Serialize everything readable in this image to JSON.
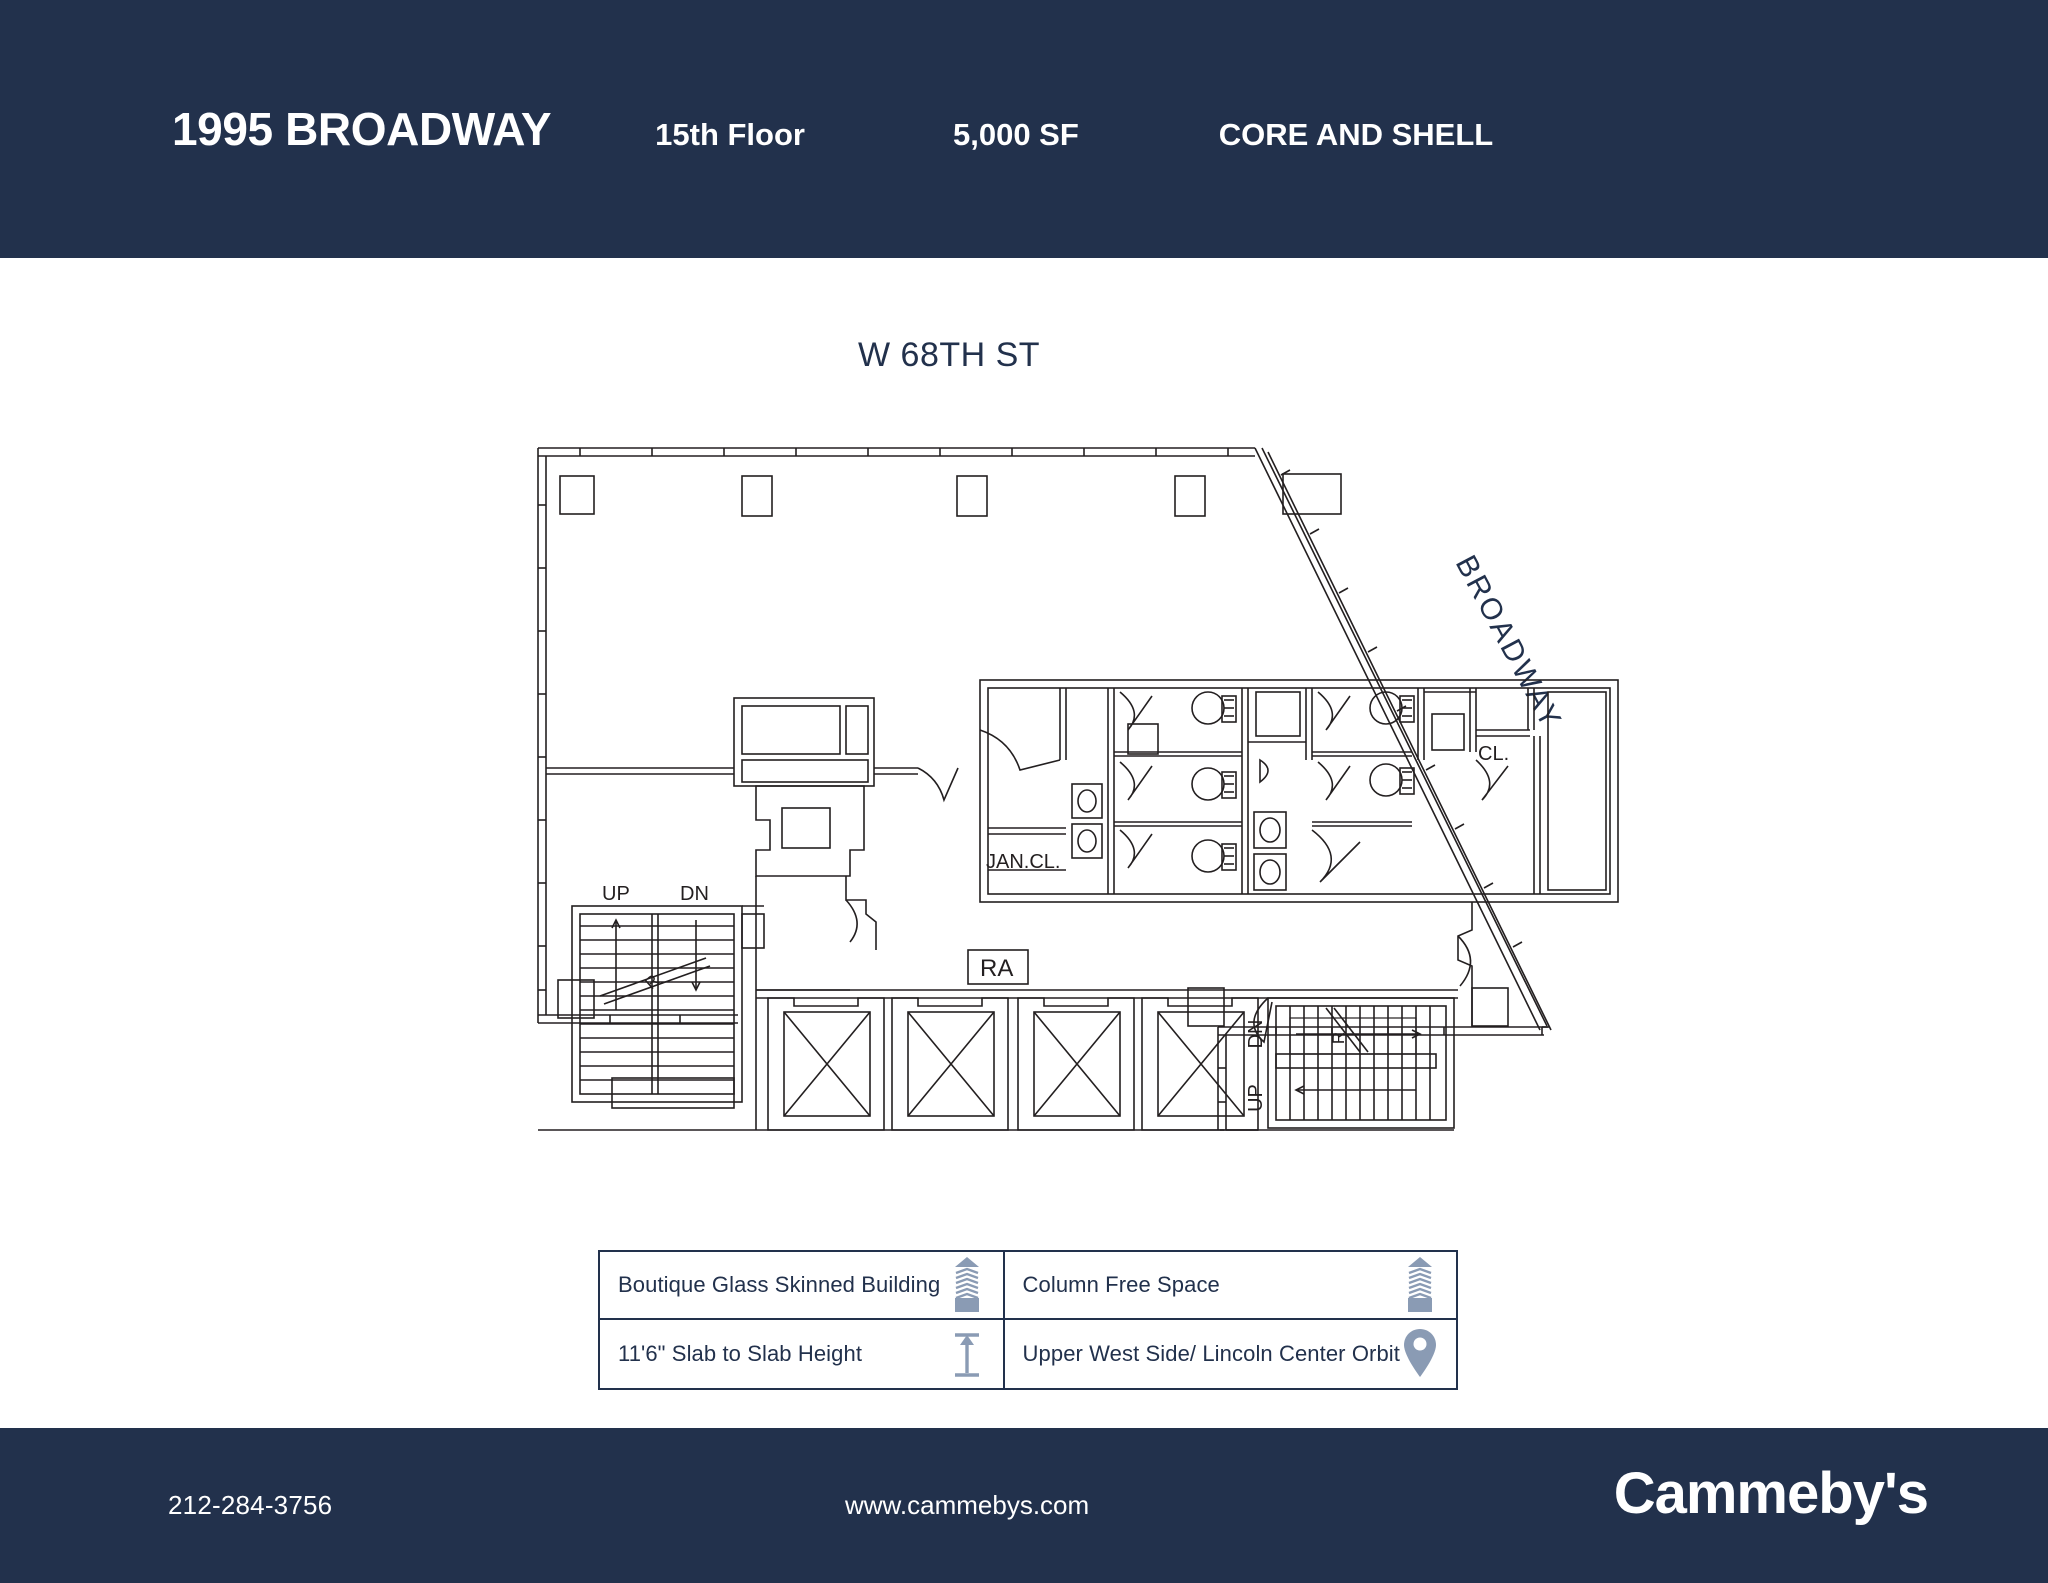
{
  "header": {
    "building_name": "1995 BROADWAY",
    "floor": "15th Floor",
    "area": "5,000 SF",
    "condition": "CORE AND SHELL",
    "bg_color": "#22314c"
  },
  "plan": {
    "street_top": "W 68TH ST",
    "street_right": "BROADWAY",
    "room_labels": [
      {
        "name": "janitor-closet",
        "text": "JAN.CL."
      },
      {
        "name": "closet",
        "text": "CL."
      },
      {
        "name": "return-air",
        "text": "RA"
      }
    ],
    "stair_labels": {
      "west_up": "UP",
      "west_dn": "DN",
      "east_up": "UP",
      "east_dn": "DN",
      "riser_count": "R"
    },
    "elevator_count": 4,
    "column_count": 7,
    "line_color": "#231f20"
  },
  "legend": {
    "items": [
      {
        "label": "Boutique Glass Skinned Building",
        "icon": "building-icon"
      },
      {
        "label": "Column Free Space",
        "icon": "building-icon"
      },
      {
        "label": "11'6\" Slab to Slab Height",
        "icon": "slab-height-arrow-icon"
      },
      {
        "label": "Upper West Side/ Lincoln Center Orbit",
        "icon": "location-pin-icon"
      }
    ],
    "border_color": "#22314c",
    "icon_color": "#8a9bb4"
  },
  "footer": {
    "phone": "212-284-3756",
    "website": "www.cammebys.com",
    "logo": "Cammeby's",
    "bg_color": "#22314c"
  }
}
